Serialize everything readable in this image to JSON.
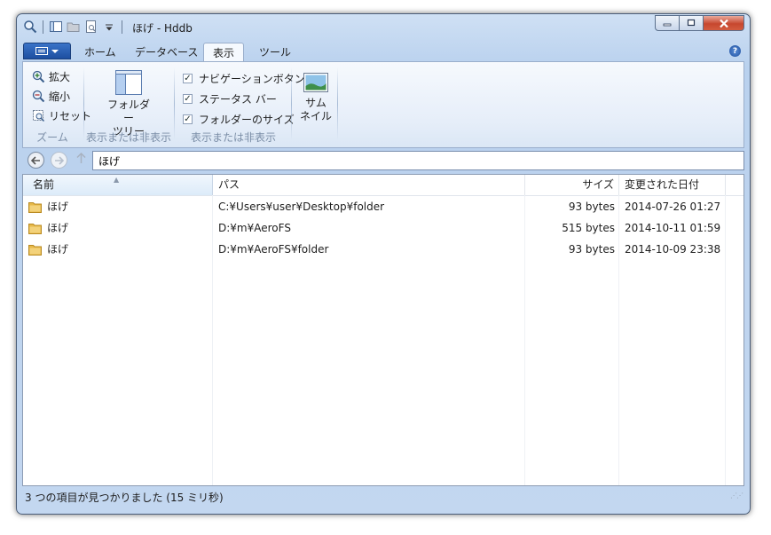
{
  "window": {
    "title": "ほげ - Hddb"
  },
  "tabs": {
    "home": "ホーム",
    "database": "データベース",
    "view": "表示",
    "tools": "ツール"
  },
  "ribbon": {
    "zoom_in": "拡大",
    "zoom_out": "縮小",
    "reset": "リセット",
    "zoom_group": "ズーム",
    "folder_tree_line1": "フォルダー",
    "folder_tree_line2": "ツリー",
    "show_hide_group": "表示または非表示",
    "checks": [
      {
        "label": "ナビゲーションボタン",
        "checked": true
      },
      {
        "label": "ステータス バー",
        "checked": true
      },
      {
        "label": "フォルダーのサイズ",
        "checked": true
      }
    ],
    "check_mark": "✓",
    "thumbnail_line1": "サム",
    "thumbnail_line2": "ネイル"
  },
  "address": {
    "value": "ほげ"
  },
  "columns": {
    "name": "名前",
    "path": "パス",
    "size": "サイズ",
    "modified": "変更された日付"
  },
  "files": [
    {
      "name": "ほげ",
      "path": "C:¥Users¥user¥Desktop¥folder",
      "size": "93 bytes",
      "modified": "2014-07-26 01:27"
    },
    {
      "name": "ほげ",
      "path": "D:¥m¥AeroFS",
      "size": "515 bytes",
      "modified": "2014-10-11 01:59"
    },
    {
      "name": "ほげ",
      "path": "D:¥m¥AeroFS¥folder",
      "size": "93 bytes",
      "modified": "2014-10-09 23:38"
    }
  ],
  "status": {
    "text": "3 つの項目が見つかりました (15 ミリ秒)"
  },
  "colors": {
    "folder": "#e7b94a",
    "accent": "#1d4fa0",
    "close": "#c7472f"
  }
}
